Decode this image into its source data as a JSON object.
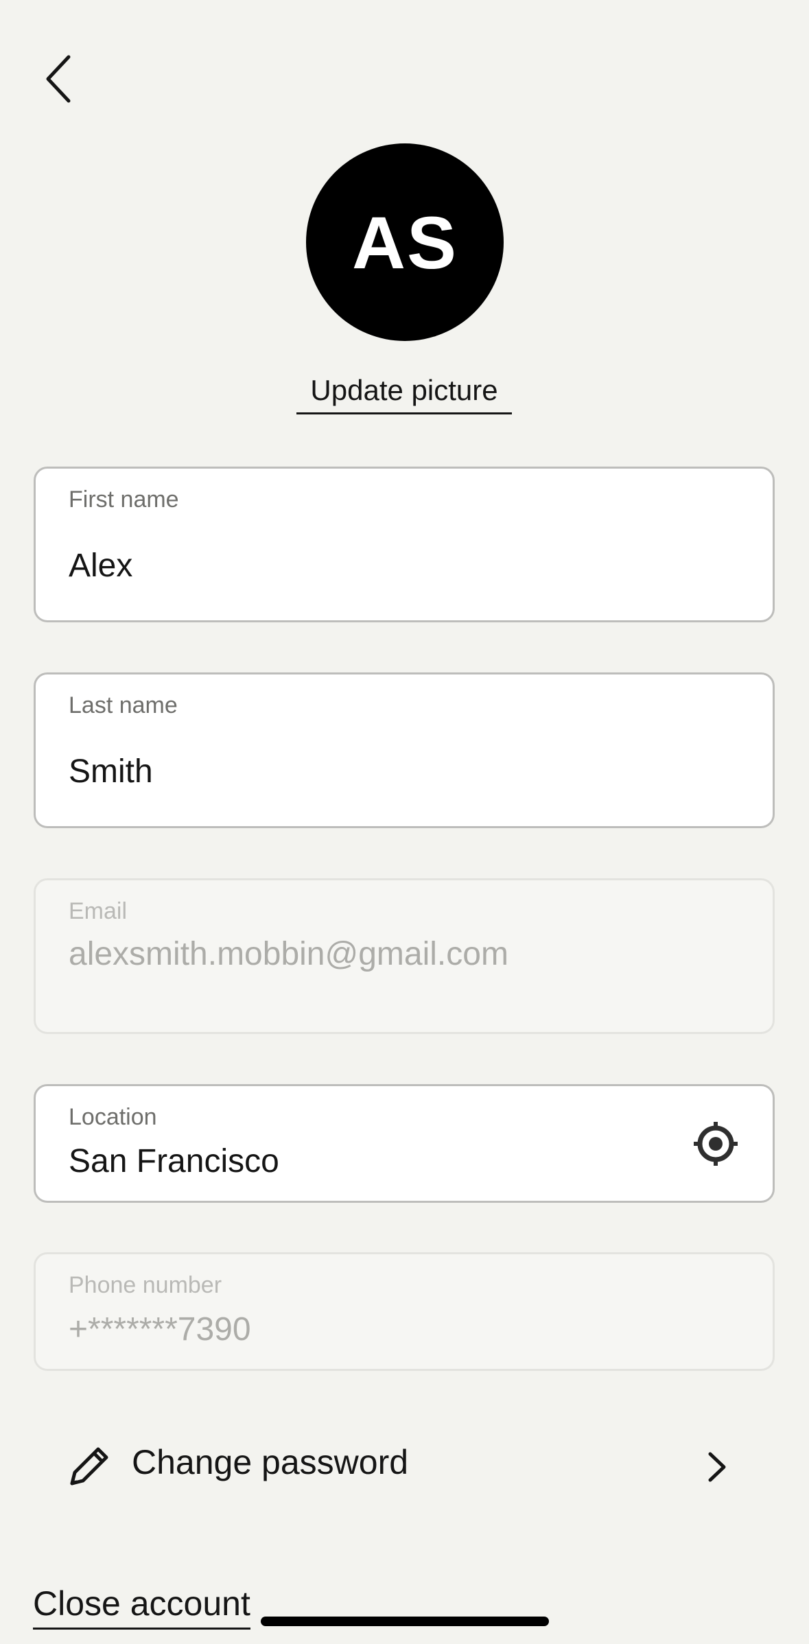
{
  "header": {
    "back_icon": "chevron-left-icon"
  },
  "profile": {
    "initials": "AS",
    "avatar_bg": "#000000",
    "update_picture_label": "Update picture"
  },
  "fields": {
    "first_name": {
      "label": "First name",
      "value": "Alex"
    },
    "last_name": {
      "label": "Last name",
      "value": "Smith"
    },
    "email": {
      "label": "Email",
      "value": "alexsmith.mobbin@gmail.com",
      "disabled": true
    },
    "location": {
      "label": "Location",
      "value": "San Francisco",
      "icon": "crosshair-locate-icon"
    },
    "phone": {
      "label": "Phone number",
      "value": "+*******7390",
      "disabled": true
    }
  },
  "actions": {
    "change_password_label": "Change password",
    "change_password_icon": "pencil-icon",
    "close_account_label": "Close account"
  },
  "colors": {
    "background": "#f3f3ef",
    "field_border": "#bdbdbb",
    "disabled_text": "#acaca8"
  }
}
